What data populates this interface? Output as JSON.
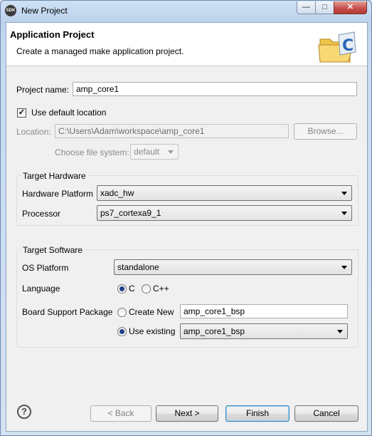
{
  "window": {
    "app_icon": "sdk-icon",
    "title": "New Project",
    "controls": {
      "minimize": "minimize-icon",
      "maximize": "maximize-icon",
      "close": "close-icon"
    }
  },
  "header": {
    "title": "Application Project",
    "subtitle": "Create a managed make application project.",
    "icon": "folder-c-icon"
  },
  "project": {
    "name_label": "Project name:",
    "name_value": "amp_core1",
    "use_default_label": "Use default location",
    "use_default_checked": true,
    "location_label": "Location:",
    "location_value": "C:\\Users\\Adam\\workspace\\amp_core1",
    "browse_label": "Browse...",
    "fs_label": "Choose file system:",
    "fs_value": "default"
  },
  "target_hardware": {
    "title": "Target Hardware",
    "platform_label": "Hardware Platform",
    "platform_value": "xadc_hw",
    "processor_label": "Processor",
    "processor_value": "ps7_cortexa9_1"
  },
  "target_software": {
    "title": "Target Software",
    "os_label": "OS Platform",
    "os_value": "standalone",
    "language_label": "Language",
    "lang_c": "C",
    "lang_cpp": "C++",
    "selected_language": "C",
    "bsp_label": "Board Support Package",
    "create_new_label": "Create New",
    "create_new_value": "amp_core1_bsp",
    "use_existing_label": "Use existing",
    "use_existing_value": "amp_core1_bsp",
    "selected_bsp": "Use existing"
  },
  "buttons": {
    "help": "?",
    "back": "< Back",
    "next": "Next >",
    "finish": "Finish",
    "cancel": "Cancel"
  }
}
